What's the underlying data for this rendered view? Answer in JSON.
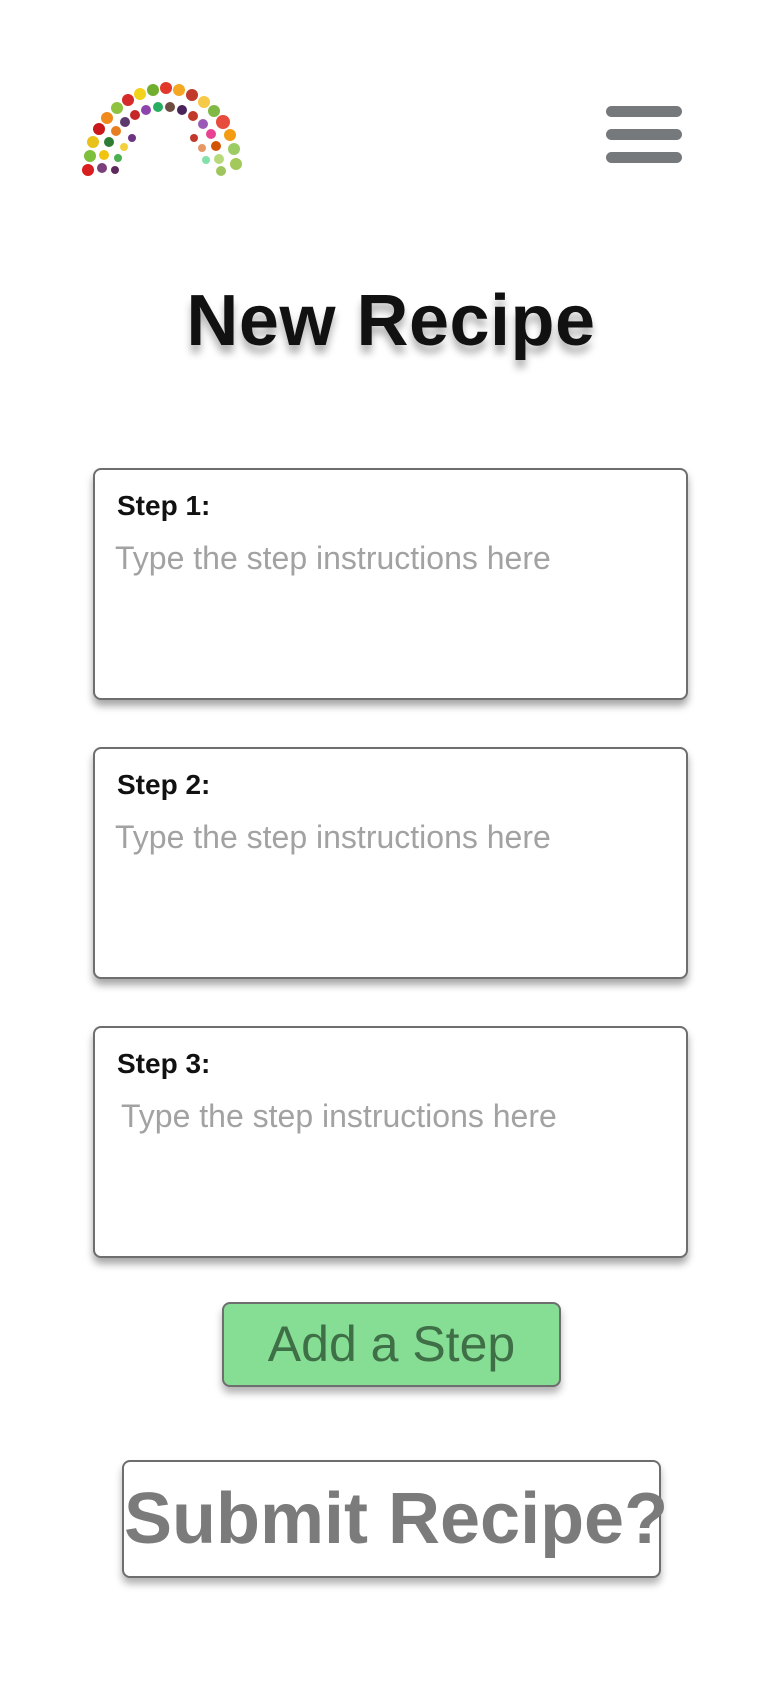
{
  "header": {
    "logo_icon": "fruit-vegetable-rainbow-logo",
    "menu_icon": "hamburger-menu-icon",
    "menu_color": "#76797c"
  },
  "main": {
    "title": "New Recipe",
    "steps": [
      {
        "label": "Step 1:",
        "placeholder": "Type the step instructions here",
        "value": ""
      },
      {
        "label": "Step 2:",
        "placeholder": "Type the step instructions here",
        "value": ""
      },
      {
        "label": "Step 3:",
        "placeholder": "Type the step instructions here",
        "value": ""
      }
    ],
    "add_step_label": "Add a Step",
    "add_step_color": "#86de94",
    "submit_label": "Submit Recipe?"
  }
}
